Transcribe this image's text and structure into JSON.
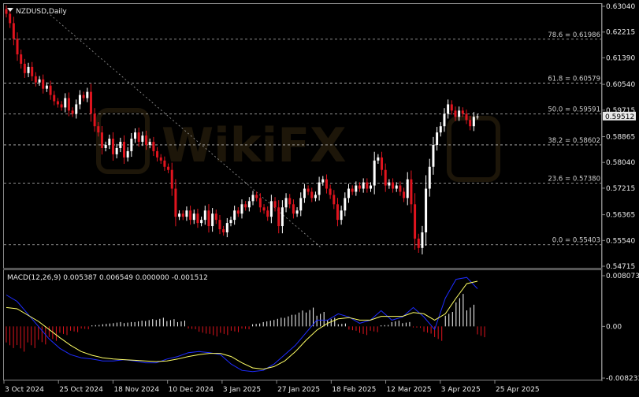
{
  "chart_title": "NZDUSD,Daily",
  "macd_title": "MACD(12,26,9) 0.005387 0.006549 0.000000 -0.001512",
  "current_price": "0.59512",
  "colors": {
    "background": "#000000",
    "bull": "#ffffff",
    "bear": "#e0141e",
    "macd_line": "#1e2cff",
    "signal_line": "#ffff66",
    "hist_pos": "#ffffff",
    "hist_neg": "#e0141e",
    "fib": "#bdbdbd",
    "grid": "#444444"
  },
  "chart_data": [
    {
      "type": "candlestick",
      "title": "NZDUSD,Daily",
      "ylim": [
        0.54715,
        0.6304
      ],
      "y_ticks": [
        "0.63040",
        "0.62215",
        "0.61390",
        "0.60540",
        "0.59715",
        "0.58865",
        "0.58040",
        "0.57215",
        "0.56365",
        "0.55540",
        "0.54715"
      ],
      "x_ticks": [
        "3 Oct 2024",
        "25 Oct 2024",
        "18 Nov 2024",
        "10 Dec 2024",
        "3 Jan 2025",
        "27 Jan 2025",
        "18 Feb 2025",
        "12 Mar 2025",
        "3 Apr 2025",
        "25 Apr 2025"
      ],
      "fib_levels": [
        {
          "label": "78.6 = 0.61986",
          "value": 0.61986
        },
        {
          "label": "61.8 = 0.60579",
          "value": 0.60579
        },
        {
          "label": "50.0 = 0.59591",
          "value": 0.59591
        },
        {
          "label": "38.2 = 0.58602",
          "value": 0.58602
        },
        {
          "label": "23.6 = 0.57380",
          "value": 0.5738
        },
        {
          "label": "0.0 = 0.55403",
          "value": 0.55403
        }
      ],
      "close_series": [
        0.628,
        0.625,
        0.62,
        0.615,
        0.612,
        0.609,
        0.611,
        0.608,
        0.606,
        0.607,
        0.604,
        0.605,
        0.602,
        0.6,
        0.599,
        0.598,
        0.601,
        0.597,
        0.596,
        0.599,
        0.602,
        0.601,
        0.603,
        0.596,
        0.592,
        0.59,
        0.585,
        0.586,
        0.588,
        0.583,
        0.585,
        0.587,
        0.582,
        0.584,
        0.588,
        0.59,
        0.587,
        0.589,
        0.586,
        0.587,
        0.584,
        0.582,
        0.581,
        0.579,
        0.578,
        0.572,
        0.563,
        0.564,
        0.563,
        0.565,
        0.562,
        0.564,
        0.561,
        0.562,
        0.565,
        0.56,
        0.564,
        0.562,
        0.559,
        0.558,
        0.561,
        0.562,
        0.565,
        0.564,
        0.567,
        0.566,
        0.568,
        0.57,
        0.569,
        0.566,
        0.565,
        0.563,
        0.568,
        0.566,
        0.56,
        0.566,
        0.569,
        0.567,
        0.564,
        0.565,
        0.569,
        0.572,
        0.571,
        0.569,
        0.57,
        0.574,
        0.575,
        0.572,
        0.57,
        0.567,
        0.562,
        0.565,
        0.569,
        0.572,
        0.571,
        0.573,
        0.572,
        0.574,
        0.572,
        0.573,
        0.581,
        0.582,
        0.578,
        0.573,
        0.574,
        0.572,
        0.573,
        0.571,
        0.569,
        0.575,
        0.567,
        0.556,
        0.553,
        0.558,
        0.572,
        0.579,
        0.586,
        0.59,
        0.592,
        0.596,
        0.599,
        0.597,
        0.595,
        0.597,
        0.596,
        0.594,
        0.592,
        0.595,
        0.5951
      ]
    },
    {
      "type": "line",
      "title": "MACD(12,26,9) 0.005387 0.006549 0.000000 -0.001512",
      "ylim": [
        -0.008233,
        0.008073
      ],
      "y_ticks": [
        "0.008073",
        "0.00",
        "-0.008233"
      ],
      "series": [
        {
          "name": "MACD",
          "values": [
            0.005,
            0.004,
            0.002,
            0.0,
            -0.002,
            -0.0035,
            -0.0045,
            -0.005,
            -0.0052,
            -0.0055,
            -0.0055,
            -0.0053,
            -0.0055,
            -0.0058,
            -0.0058,
            -0.0052,
            -0.0048,
            -0.0042,
            -0.004,
            -0.0042,
            -0.0045,
            -0.006,
            -0.007,
            -0.0072,
            -0.007,
            -0.006,
            -0.0045,
            -0.003,
            -0.001,
            0.001,
            0.001,
            0.002,
            0.0015,
            0.0005,
            0.001,
            0.0025,
            0.001,
            0.0015,
            0.003,
            0.0015,
            -0.0005,
            0.0045,
            0.0075,
            0.0078,
            0.006
          ]
        },
        {
          "name": "Signal",
          "values": [
            0.003,
            0.0028,
            0.0018,
            0.0008,
            -0.0005,
            -0.0018,
            -0.003,
            -0.004,
            -0.0046,
            -0.005,
            -0.0052,
            -0.0053,
            -0.0054,
            -0.0055,
            -0.0056,
            -0.0055,
            -0.0052,
            -0.0048,
            -0.0045,
            -0.0043,
            -0.0043,
            -0.0048,
            -0.0058,
            -0.0066,
            -0.0068,
            -0.0064,
            -0.0055,
            -0.004,
            -0.0022,
            -0.0006,
            0.0005,
            0.0012,
            0.0014,
            0.001,
            0.001,
            0.0016,
            0.0016,
            0.0016,
            0.0022,
            0.002,
            0.001,
            0.002,
            0.0045,
            0.0068,
            0.0072
          ]
        },
        {
          "name": "Histogram",
          "values": [
            -0.003,
            -0.0035,
            -0.003,
            -0.0025,
            -0.002,
            -0.0012,
            -0.0008,
            -0.0004,
            0.0002,
            0.0004,
            0.0006,
            0.0006,
            0.0008,
            0.001,
            0.0012,
            0.001,
            0.0008,
            -0.0004,
            -0.001,
            -0.0014,
            -0.0012,
            -0.0008,
            -0.0004,
            0.0004,
            0.0008,
            0.0012,
            0.0016,
            0.0022,
            0.0026,
            0.002,
            0.0012,
            0.0004,
            -0.0006,
            -0.0012,
            -0.0008,
            0.0002,
            0.0008,
            0.0006,
            -0.0002,
            -0.001,
            -0.002,
            0.002,
            0.0045,
            0.003,
            -0.0015
          ]
        }
      ]
    }
  ]
}
